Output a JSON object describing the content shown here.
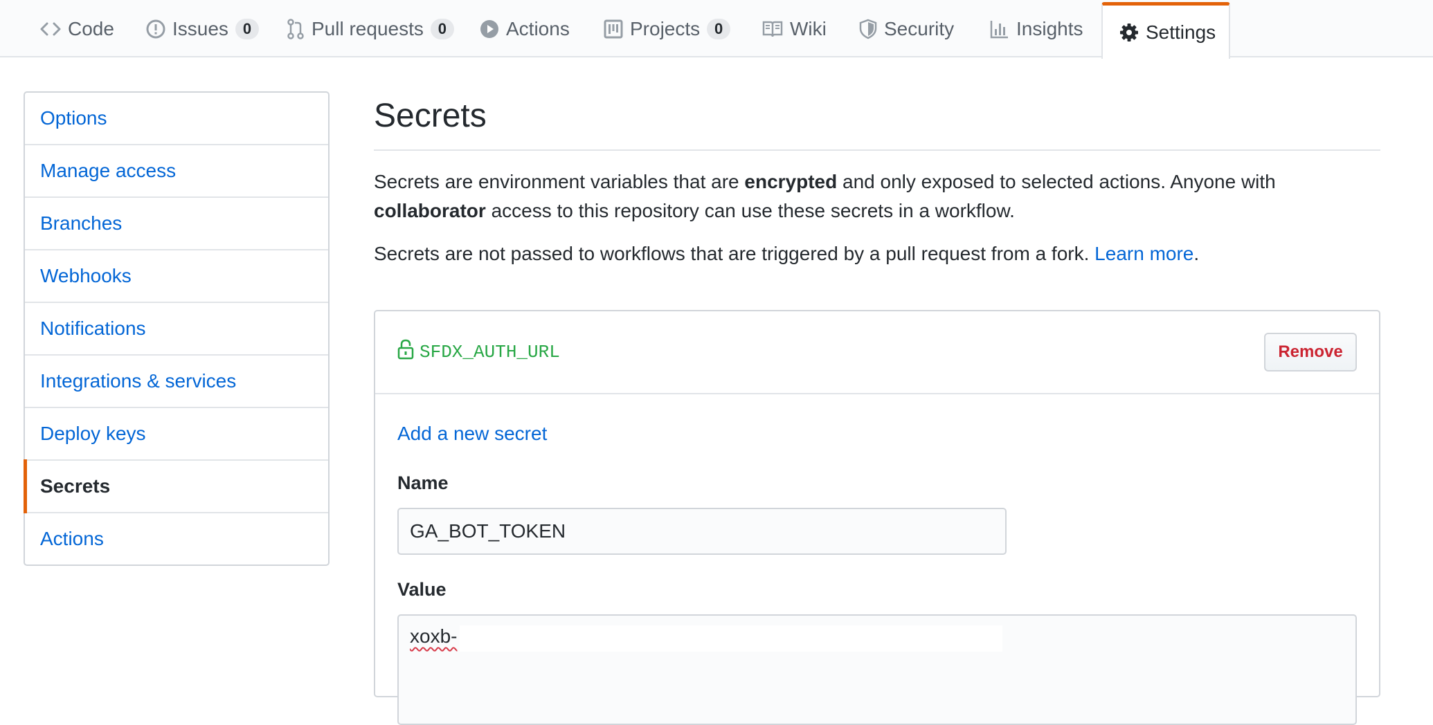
{
  "tabs": [
    {
      "label": "Code",
      "icon": "code-icon"
    },
    {
      "label": "Issues",
      "icon": "issue-icon",
      "count": "0"
    },
    {
      "label": "Pull requests",
      "icon": "pull-request-icon",
      "count": "0"
    },
    {
      "label": "Actions",
      "icon": "play-icon"
    },
    {
      "label": "Projects",
      "icon": "project-icon",
      "count": "0"
    },
    {
      "label": "Wiki",
      "icon": "book-icon"
    },
    {
      "label": "Security",
      "icon": "shield-icon"
    },
    {
      "label": "Insights",
      "icon": "graph-icon"
    },
    {
      "label": "Settings",
      "icon": "gear-icon",
      "selected": true
    }
  ],
  "sidebar": {
    "items": [
      {
        "label": "Options"
      },
      {
        "label": "Manage access"
      },
      {
        "label": "Branches"
      },
      {
        "label": "Webhooks"
      },
      {
        "label": "Notifications"
      },
      {
        "label": "Integrations & services"
      },
      {
        "label": "Deploy keys"
      },
      {
        "label": "Secrets",
        "selected": true
      },
      {
        "label": "Actions"
      }
    ]
  },
  "main": {
    "title": "Secrets",
    "desc1": {
      "part1": "Secrets are environment variables that are ",
      "bold1": "encrypted",
      "part2": " and only exposed to selected actions. Anyone with ",
      "bold2": "collaborator",
      "part3": " access to this repository can use these secrets in a workflow."
    },
    "desc2": {
      "text": "Secrets are not passed to workflows that are triggered by a pull request from a fork. ",
      "link": "Learn more",
      "end": "."
    },
    "secret": {
      "name": "SFDX_AUTH_URL",
      "remove_label": "Remove"
    },
    "form": {
      "add_title": "Add a new secret",
      "name_label": "Name",
      "name_value": "GA_BOT_TOKEN",
      "value_label": "Value",
      "value_text": "xoxb-"
    }
  },
  "colors": {
    "accent": "#e36209",
    "link": "#0366d6",
    "secret_green": "#28a745",
    "danger": "#cb2431"
  }
}
